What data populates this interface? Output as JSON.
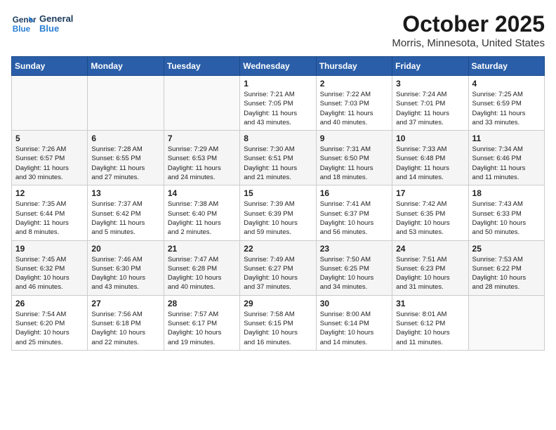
{
  "header": {
    "logo_general": "General",
    "logo_blue": "Blue",
    "month": "October 2025",
    "location": "Morris, Minnesota, United States"
  },
  "weekdays": [
    "Sunday",
    "Monday",
    "Tuesday",
    "Wednesday",
    "Thursday",
    "Friday",
    "Saturday"
  ],
  "weeks": [
    [
      {
        "day": "",
        "info": ""
      },
      {
        "day": "",
        "info": ""
      },
      {
        "day": "",
        "info": ""
      },
      {
        "day": "1",
        "info": "Sunrise: 7:21 AM\nSunset: 7:05 PM\nDaylight: 11 hours\nand 43 minutes."
      },
      {
        "day": "2",
        "info": "Sunrise: 7:22 AM\nSunset: 7:03 PM\nDaylight: 11 hours\nand 40 minutes."
      },
      {
        "day": "3",
        "info": "Sunrise: 7:24 AM\nSunset: 7:01 PM\nDaylight: 11 hours\nand 37 minutes."
      },
      {
        "day": "4",
        "info": "Sunrise: 7:25 AM\nSunset: 6:59 PM\nDaylight: 11 hours\nand 33 minutes."
      }
    ],
    [
      {
        "day": "5",
        "info": "Sunrise: 7:26 AM\nSunset: 6:57 PM\nDaylight: 11 hours\nand 30 minutes."
      },
      {
        "day": "6",
        "info": "Sunrise: 7:28 AM\nSunset: 6:55 PM\nDaylight: 11 hours\nand 27 minutes."
      },
      {
        "day": "7",
        "info": "Sunrise: 7:29 AM\nSunset: 6:53 PM\nDaylight: 11 hours\nand 24 minutes."
      },
      {
        "day": "8",
        "info": "Sunrise: 7:30 AM\nSunset: 6:51 PM\nDaylight: 11 hours\nand 21 minutes."
      },
      {
        "day": "9",
        "info": "Sunrise: 7:31 AM\nSunset: 6:50 PM\nDaylight: 11 hours\nand 18 minutes."
      },
      {
        "day": "10",
        "info": "Sunrise: 7:33 AM\nSunset: 6:48 PM\nDaylight: 11 hours\nand 14 minutes."
      },
      {
        "day": "11",
        "info": "Sunrise: 7:34 AM\nSunset: 6:46 PM\nDaylight: 11 hours\nand 11 minutes."
      }
    ],
    [
      {
        "day": "12",
        "info": "Sunrise: 7:35 AM\nSunset: 6:44 PM\nDaylight: 11 hours\nand 8 minutes."
      },
      {
        "day": "13",
        "info": "Sunrise: 7:37 AM\nSunset: 6:42 PM\nDaylight: 11 hours\nand 5 minutes."
      },
      {
        "day": "14",
        "info": "Sunrise: 7:38 AM\nSunset: 6:40 PM\nDaylight: 11 hours\nand 2 minutes."
      },
      {
        "day": "15",
        "info": "Sunrise: 7:39 AM\nSunset: 6:39 PM\nDaylight: 10 hours\nand 59 minutes."
      },
      {
        "day": "16",
        "info": "Sunrise: 7:41 AM\nSunset: 6:37 PM\nDaylight: 10 hours\nand 56 minutes."
      },
      {
        "day": "17",
        "info": "Sunrise: 7:42 AM\nSunset: 6:35 PM\nDaylight: 10 hours\nand 53 minutes."
      },
      {
        "day": "18",
        "info": "Sunrise: 7:43 AM\nSunset: 6:33 PM\nDaylight: 10 hours\nand 50 minutes."
      }
    ],
    [
      {
        "day": "19",
        "info": "Sunrise: 7:45 AM\nSunset: 6:32 PM\nDaylight: 10 hours\nand 46 minutes."
      },
      {
        "day": "20",
        "info": "Sunrise: 7:46 AM\nSunset: 6:30 PM\nDaylight: 10 hours\nand 43 minutes."
      },
      {
        "day": "21",
        "info": "Sunrise: 7:47 AM\nSunset: 6:28 PM\nDaylight: 10 hours\nand 40 minutes."
      },
      {
        "day": "22",
        "info": "Sunrise: 7:49 AM\nSunset: 6:27 PM\nDaylight: 10 hours\nand 37 minutes."
      },
      {
        "day": "23",
        "info": "Sunrise: 7:50 AM\nSunset: 6:25 PM\nDaylight: 10 hours\nand 34 minutes."
      },
      {
        "day": "24",
        "info": "Sunrise: 7:51 AM\nSunset: 6:23 PM\nDaylight: 10 hours\nand 31 minutes."
      },
      {
        "day": "25",
        "info": "Sunrise: 7:53 AM\nSunset: 6:22 PM\nDaylight: 10 hours\nand 28 minutes."
      }
    ],
    [
      {
        "day": "26",
        "info": "Sunrise: 7:54 AM\nSunset: 6:20 PM\nDaylight: 10 hours\nand 25 minutes."
      },
      {
        "day": "27",
        "info": "Sunrise: 7:56 AM\nSunset: 6:18 PM\nDaylight: 10 hours\nand 22 minutes."
      },
      {
        "day": "28",
        "info": "Sunrise: 7:57 AM\nSunset: 6:17 PM\nDaylight: 10 hours\nand 19 minutes."
      },
      {
        "day": "29",
        "info": "Sunrise: 7:58 AM\nSunset: 6:15 PM\nDaylight: 10 hours\nand 16 minutes."
      },
      {
        "day": "30",
        "info": "Sunrise: 8:00 AM\nSunset: 6:14 PM\nDaylight: 10 hours\nand 14 minutes."
      },
      {
        "day": "31",
        "info": "Sunrise: 8:01 AM\nSunset: 6:12 PM\nDaylight: 10 hours\nand 11 minutes."
      },
      {
        "day": "",
        "info": ""
      }
    ]
  ]
}
